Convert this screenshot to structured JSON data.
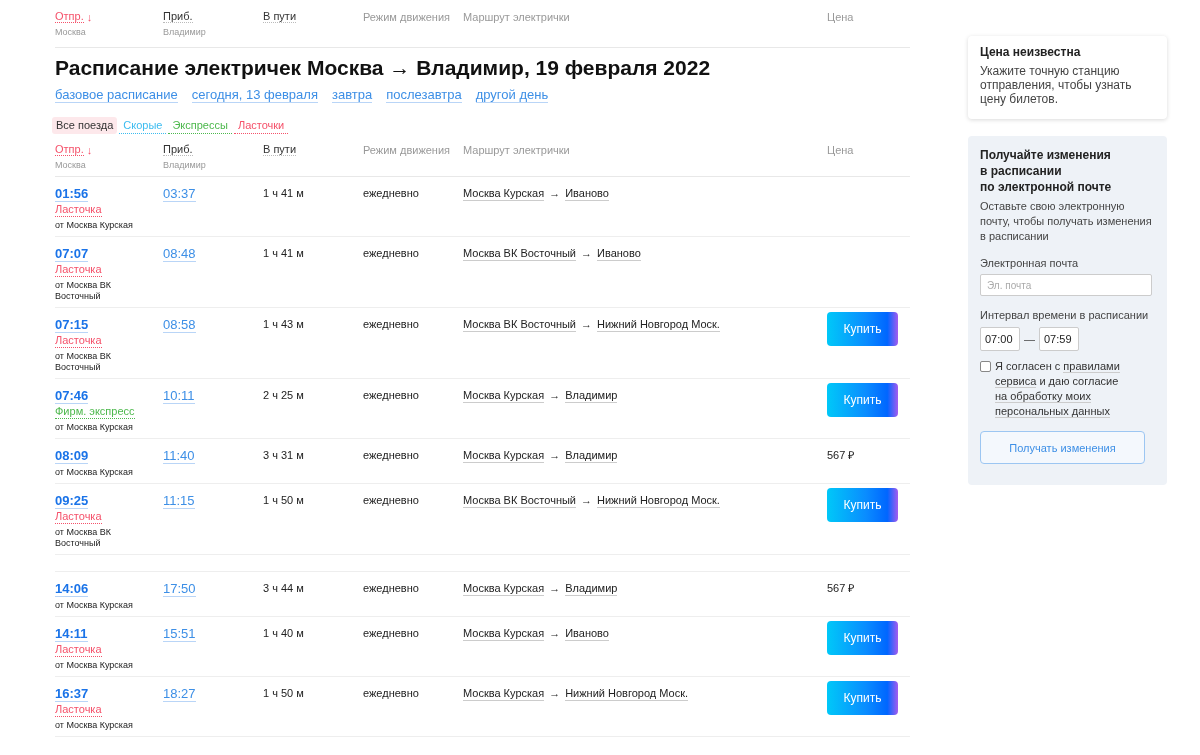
{
  "sticky_header": {
    "columns": [
      {
        "label": "Отпр.",
        "sub": "Москва",
        "sort_arrow": "↓",
        "selected": true,
        "sortable": true
      },
      {
        "label": "Приб.",
        "sub": "Владимир",
        "selected": false,
        "sortable": true
      },
      {
        "label": "В пути",
        "selected": false,
        "sortable": true
      },
      {
        "label": "Режим движения",
        "selected": false,
        "sortable": false
      },
      {
        "label": "Маршрут электрички",
        "selected": false,
        "sortable": false
      },
      {
        "label": "Цена",
        "selected": false,
        "sortable": false
      }
    ]
  },
  "title": "Расписание электричек Москва → Владимир, 19 февраля 2022",
  "date_links": [
    "базовое расписание",
    "сегодня, 13 февраля",
    "завтра",
    "послезавтра",
    "другой день"
  ],
  "filters": [
    {
      "label": "Все поезда",
      "selected": true,
      "color": "#333333"
    },
    {
      "label": "Скорые",
      "selected": false,
      "color": "#3cbcf0"
    },
    {
      "label": "Экспрессы",
      "selected": false,
      "color": "#4cb84c"
    },
    {
      "label": "Ласточки",
      "selected": false,
      "color": "#f5516a"
    }
  ],
  "table": {
    "columns": [
      {
        "label": "Отпр.",
        "sub": "Москва",
        "sort_arrow": "↓",
        "selected": true,
        "sortable": true
      },
      {
        "label": "Приб.",
        "sub": "Владимир",
        "selected": false,
        "sortable": true
      },
      {
        "label": "В пути",
        "selected": false,
        "sortable": true
      },
      {
        "label": "Режим движения",
        "selected": false,
        "sortable": false
      },
      {
        "label": "Маршрут электрички",
        "selected": false,
        "sortable": false
      },
      {
        "label": "Цена",
        "selected": false,
        "sortable": false
      }
    ],
    "rows": [
      {
        "kind": "train",
        "dep": "01:56",
        "type": {
          "label": "Ласточка",
          "color": "#f5516a"
        },
        "station": "от Москва Курская",
        "arr": "03:37",
        "duration": "1 ч 41 м",
        "mode": "ежедневно",
        "from": "Москва Курская",
        "arrow": "→",
        "to": "Иваново"
      },
      {
        "kind": "train",
        "dep": "07:07",
        "type": {
          "label": "Ласточка",
          "color": "#f5516a"
        },
        "station": "от Москва ВК Восточный",
        "arr": "08:48",
        "duration": "1 ч 41 м",
        "mode": "ежедневно",
        "from": "Москва ВК Восточный",
        "arrow": "→",
        "to": "Иваново"
      },
      {
        "kind": "train",
        "dep": "07:15",
        "type": {
          "label": "Ласточка",
          "color": "#f5516a"
        },
        "station": "от Москва ВК Восточный",
        "arr": "08:58",
        "duration": "1 ч 43 м",
        "mode": "ежедневно",
        "from": "Москва ВК Восточный",
        "arrow": "→",
        "to": "Нижний Новгород Моск.",
        "price": {
          "kind": "buy",
          "label": "Купить"
        }
      },
      {
        "kind": "train",
        "dep": "07:46",
        "type": {
          "label": "Фирм. экспресс",
          "color": "#4cb84c"
        },
        "station": "от Москва Курская",
        "arr": "10:11",
        "duration": "2 ч 25 м",
        "mode": "ежедневно",
        "from": "Москва Курская",
        "arrow": "→",
        "to": "Владимир",
        "price": {
          "kind": "buy",
          "label": "Купить"
        }
      },
      {
        "kind": "train",
        "dep": "08:09",
        "station": "от Москва Курская",
        "arr": "11:40",
        "duration": "3 ч 31 м",
        "mode": "ежедневно",
        "from": "Москва Курская",
        "arrow": "→",
        "to": "Владимир",
        "price": {
          "kind": "amount",
          "label": "567 ₽"
        }
      },
      {
        "kind": "train",
        "dep": "09:25",
        "type": {
          "label": "Ласточка",
          "color": "#f5516a"
        },
        "station": "от Москва ВК Восточный",
        "arr": "11:15",
        "duration": "1 ч 50 м",
        "mode": "ежедневно",
        "from": "Москва ВК Восточный",
        "arrow": "→",
        "to": "Нижний Новгород Моск.",
        "price": {
          "kind": "buy",
          "label": "Купить"
        }
      },
      {
        "kind": "spacer"
      },
      {
        "kind": "train",
        "dep": "14:06",
        "station": "от Москва Курская",
        "arr": "17:50",
        "duration": "3 ч 44 м",
        "mode": "ежедневно",
        "from": "Москва Курская",
        "arrow": "→",
        "to": "Владимир",
        "price": {
          "kind": "amount",
          "label": "567 ₽"
        }
      },
      {
        "kind": "train",
        "dep": "14:11",
        "type": {
          "label": "Ласточка",
          "color": "#f5516a"
        },
        "station": "от Москва Курская",
        "arr": "15:51",
        "duration": "1 ч 40 м",
        "mode": "ежедневно",
        "from": "Москва Курская",
        "arrow": "→",
        "to": "Иваново",
        "price": {
          "kind": "buy",
          "label": "Купить"
        }
      },
      {
        "kind": "train",
        "dep": "16:37",
        "type": {
          "label": "Ласточка",
          "color": "#f5516a"
        },
        "station": "от Москва Курская",
        "arr": "18:27",
        "duration": "1 ч 50 м",
        "mode": "ежедневно",
        "from": "Москва Курская",
        "arrow": "→",
        "to": "Нижний Новгород Моск.",
        "price": {
          "kind": "buy",
          "label": "Купить"
        }
      }
    ]
  },
  "price_card": {
    "title": "Цена неизвестна",
    "text": "Укажите точную станцию отправления, чтобы узнать цену билетов."
  },
  "subscribe": {
    "title": [
      "Получайте изменения",
      "в расписании",
      "по электронной почте"
    ],
    "text": "Оставьте свою электронную почту, чтобы получать изменения в расписании",
    "email_label": "Электронная почта",
    "email_placeholder": "Эл. почта",
    "interval_label": "Интервал времени в расписании",
    "time_from": "07:00",
    "dash": "—",
    "time_to": "07:59",
    "checked": false,
    "consent": [
      {
        "text": "Я согласен с",
        "link": false
      },
      {
        "text": "правилами",
        "link": true
      },
      {
        "text": "сервиса",
        "link": true
      },
      {
        "text": "и даю согласие",
        "link": false
      },
      {
        "text": "на обработку моих",
        "link": true
      },
      {
        "text": "персональных данных",
        "link": true
      }
    ],
    "button": "Получать изменения"
  }
}
